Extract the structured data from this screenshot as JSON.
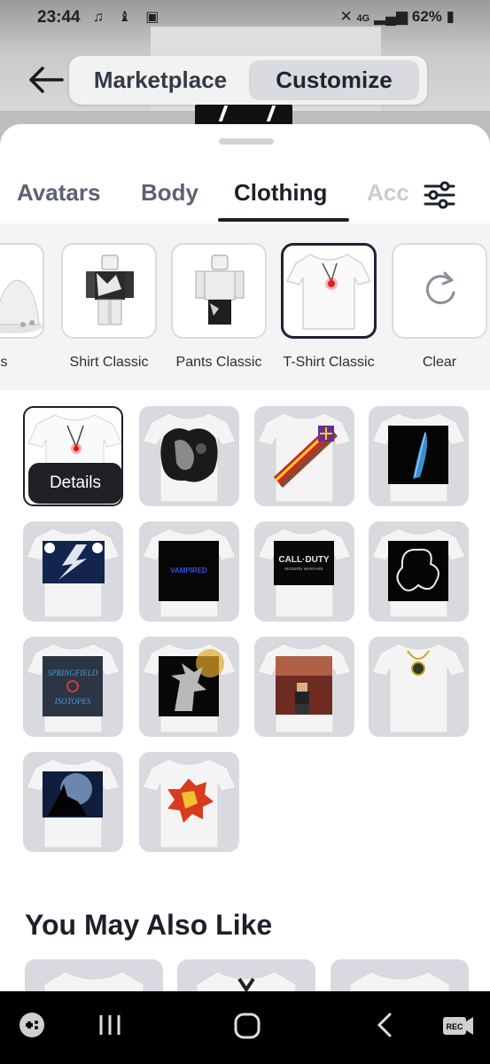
{
  "status_bar": {
    "time": "23:44",
    "left_icons": "♫ ♝ ▣",
    "network": "4G",
    "battery": "62%"
  },
  "top_nav": {
    "back_icon": "arrow-left-icon",
    "segments": [
      {
        "label": "Marketplace",
        "selected": false
      },
      {
        "label": "Customize",
        "selected": true
      }
    ]
  },
  "tabs": [
    {
      "label": "Avatars",
      "active": false
    },
    {
      "label": "Body",
      "active": false
    },
    {
      "label": "Clothing",
      "active": true
    },
    {
      "label": "Acc",
      "active": false
    }
  ],
  "categories": [
    {
      "label": "es"
    },
    {
      "label": "Shirt Classic"
    },
    {
      "label": "Pants Classic"
    },
    {
      "label": "T-Shirt Classic",
      "selected": true
    },
    {
      "label": "Clear"
    }
  ],
  "grid": {
    "details_label": "Details",
    "items": [
      {
        "design": "necklace",
        "selected": true
      },
      {
        "design": "grunge"
      },
      {
        "design": "sash"
      },
      {
        "design": "feather"
      },
      {
        "design": "lightning"
      },
      {
        "design": "vampired"
      },
      {
        "design": "cod"
      },
      {
        "design": "outline"
      },
      {
        "design": "springfield"
      },
      {
        "design": "hedgehog"
      },
      {
        "design": "robloxian"
      },
      {
        "design": "pendant"
      },
      {
        "design": "wolf"
      },
      {
        "design": "gem"
      }
    ],
    "texts": {
      "vampired": "VAMPIRED",
      "cod_top": "CALL·DUTY",
      "cod_sub": "MODERN WARFARE",
      "springfield_top": "SPRINGFIELD",
      "springfield_bottom": "ISOTOPES"
    }
  },
  "recommendations": {
    "title": "You May Also Like"
  },
  "colors": {
    "accent_dark": "#1c2029",
    "tile_bg": "#d9dae0",
    "sheet_bg": "#ffffff"
  }
}
